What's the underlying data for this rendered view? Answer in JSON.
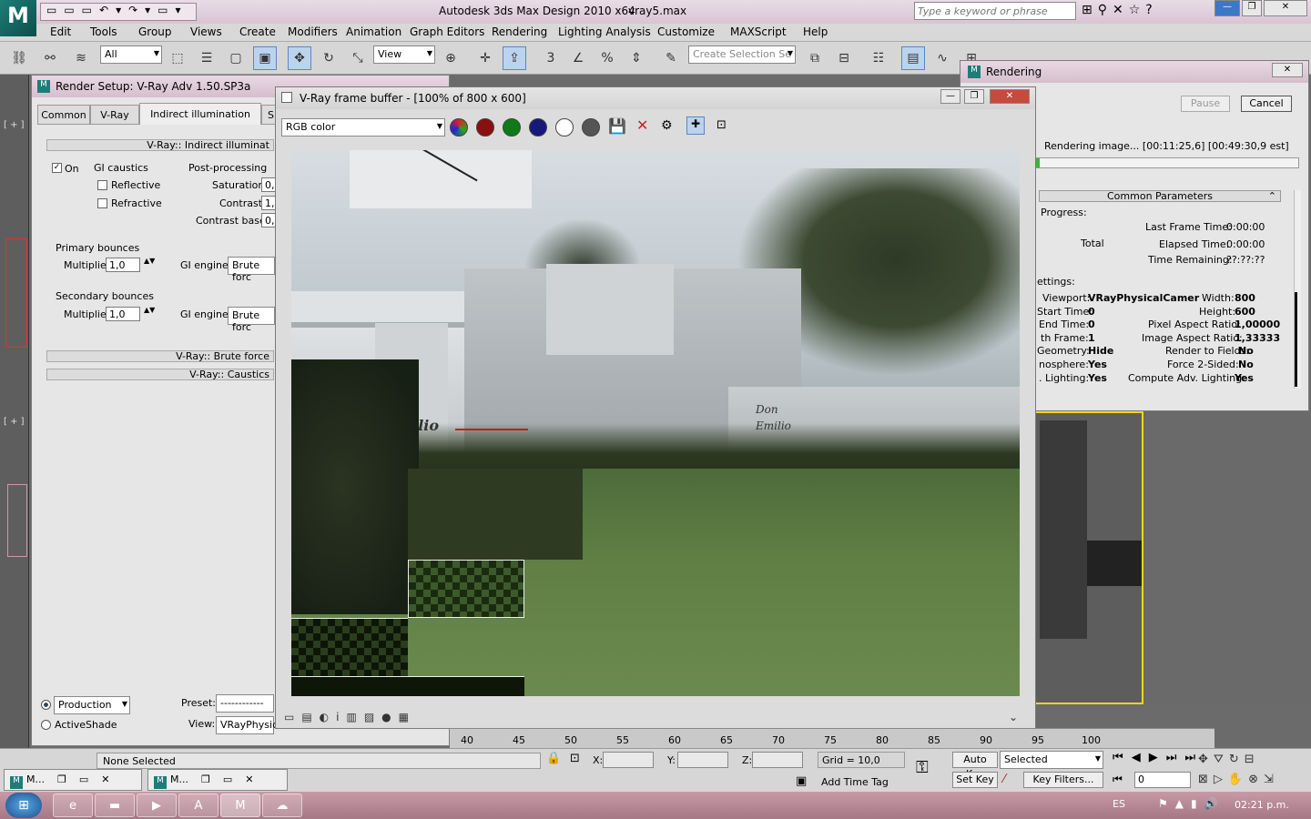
{
  "app": {
    "title": "Autodesk 3ds Max Design 2010 x64",
    "file": "vray5.max",
    "search_placeholder": "Type a keyword or phrase"
  },
  "menu": [
    "Edit",
    "Tools",
    "Group",
    "Views",
    "Create",
    "Modifiers",
    "Animation",
    "Graph Editors",
    "Rendering",
    "Lighting Analysis",
    "Customize",
    "MAXScript",
    "Help"
  ],
  "toolbar": {
    "filter": "All",
    "refcoord": "View",
    "selection_set": "Create Selection Se"
  },
  "render_setup": {
    "title": "Render Setup: V-Ray Adv 1.50.SP3a",
    "tabs": [
      "Common",
      "V-Ray",
      "Indirect illumination",
      "S"
    ],
    "rollout_gi": "V-Ray:: Indirect illuminat",
    "on_label": "On",
    "gi_caustics": "GI caustics",
    "reflective": "Reflective",
    "refractive": "Refractive",
    "post_processing": "Post-processing",
    "saturation": "Saturation",
    "saturation_val": "0,",
    "contrast": "Contrast",
    "contrast_val": "1,",
    "contrast_base": "Contrast base",
    "contrast_base_val": "0,",
    "primary_bounces": "Primary bounces",
    "multiplier": "Multiplier",
    "primary_mult": "1,0",
    "gi_engine": "GI engine",
    "primary_engine": "Brute forc",
    "secondary_bounces": "Secondary bounces",
    "secondary_mult": "1,0",
    "secondary_engine": "Brute forc",
    "rollout_brute": "V-Ray:: Brute force",
    "rollout_caustics": "V-Ray:: Caustics",
    "production": "Production",
    "activeshade": "ActiveShade",
    "preset_label": "Preset:",
    "preset_value": "------------",
    "view_label": "View:",
    "view_value": "VRayPhysica"
  },
  "framebuffer": {
    "title": "V-Ray frame buffer - [100% of 800 x 600]",
    "channel": "RGB color",
    "sign_text": "Don Emilio"
  },
  "rendering": {
    "title": "Rendering",
    "pause": "Pause",
    "cancel": "Cancel",
    "status": "Rendering image... [00:11:25,6] [00:49:30,9 est]",
    "progress": 0.02,
    "common_params": "Common Parameters",
    "progress_label": "Progress:",
    "total": "Total",
    "last_frame_time_l": "Last Frame Time:",
    "last_frame_time": "0:00:00",
    "elapsed_l": "Elapsed Time:",
    "elapsed": "0:00:00",
    "remaining_l": "Time Remaining:",
    "remaining": "??:??:??",
    "settings_l": "ettings:",
    "viewport_l": "Viewport:",
    "viewport": "VRayPhysicalCamer",
    "width_l": "Width:",
    "width": "800",
    "start_l": "Start Time:",
    "start": "0",
    "height_l": "Height:",
    "height": "600",
    "end_l": "End Time:",
    "end": "0",
    "par_l": "Pixel Aspect Ratio:",
    "par": "1,00000",
    "nth_l": "th Frame:",
    "nth": "1",
    "iar_l": "Image Aspect Ratio:",
    "iar": "1,33333",
    "geom_l": "Geometry:",
    "geom": "Hide",
    "rtf_l": "Render to Fields:",
    "rtf": "No",
    "atm_l": "nosphere:",
    "atm": "Yes",
    "f2s_l": "Force 2-Sided:",
    "f2s": "No",
    "lit_l": ". Lighting:",
    "lit": "Yes",
    "cal_l": "Compute Adv. Lighting:",
    "cal": "Yes"
  },
  "timeline": [
    "40",
    "45",
    "50",
    "55",
    "60",
    "65",
    "70",
    "75",
    "80",
    "85",
    "90",
    "95",
    "100"
  ],
  "status": {
    "none_selected": "None Selected",
    "x": "X:",
    "y": "Y:",
    "z": "Z:",
    "grid": "Grid = 10,0",
    "auto_key": "Auto Key",
    "selected": "Selected",
    "set_key": "Set Key",
    "key_filters": "Key Filters...",
    "add_time_tag": "Add Time Tag",
    "frame": "0"
  },
  "taskbar": {
    "lang": "ES",
    "clock": "02:21 p.m.",
    "mini1": "M...",
    "mini2": "M..."
  }
}
